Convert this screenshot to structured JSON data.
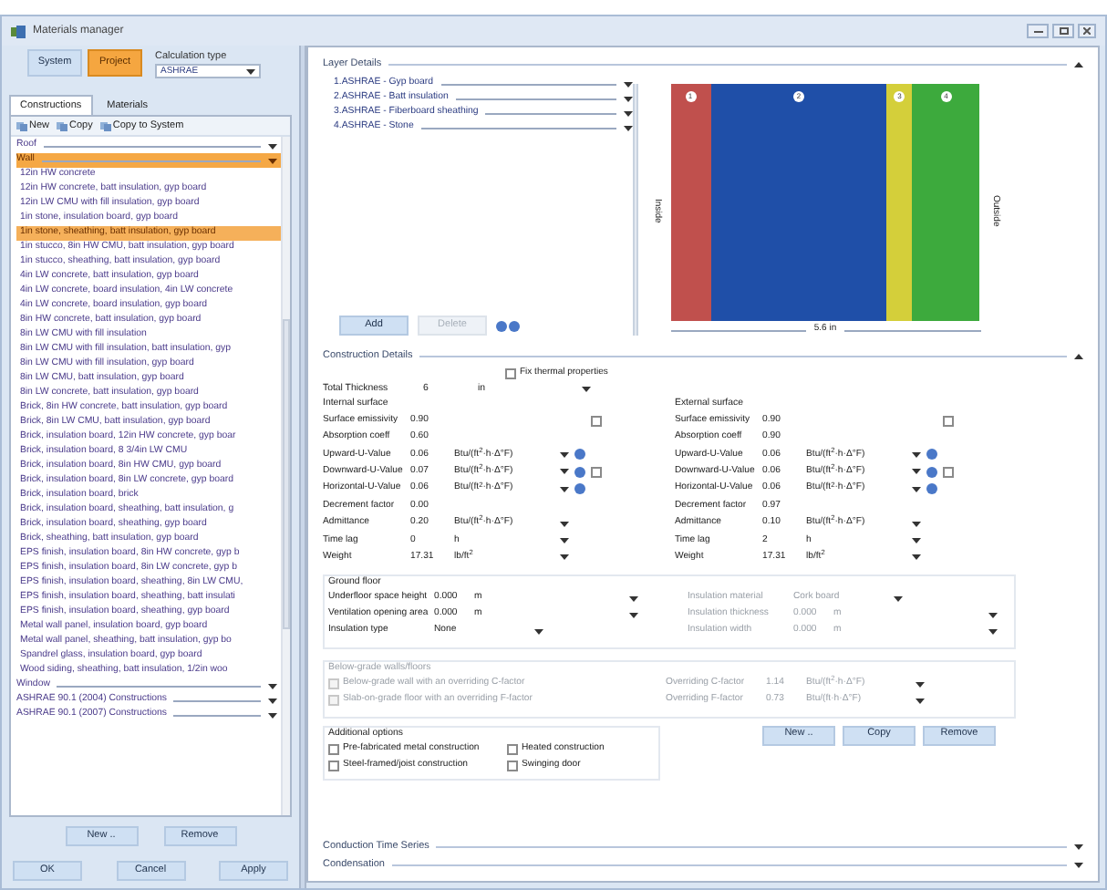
{
  "window": {
    "title": "Materials manager"
  },
  "mode_buttons": [
    {
      "label": "System",
      "selected": false
    },
    {
      "label": "Project",
      "selected": true
    }
  ],
  "calculation_type": {
    "label": "Calculation type",
    "value": "ASHRAE"
  },
  "tabs": [
    {
      "label": "Constructions",
      "selected": true
    },
    {
      "label": "Materials",
      "selected": false
    }
  ],
  "toolbar": [
    "New",
    "Copy",
    "Copy to System"
  ],
  "list": [
    {
      "kind": "group",
      "label": "Roof",
      "expanded": false,
      "selected": false
    },
    {
      "kind": "group",
      "label": "Wall",
      "expanded": true,
      "selected": true
    },
    {
      "kind": "item",
      "label": "12in HW concrete",
      "selected": false
    },
    {
      "kind": "item",
      "label": "12in HW concrete, batt insulation, gyp board",
      "selected": false
    },
    {
      "kind": "item",
      "label": "12in LW CMU with fill insulation, gyp board",
      "selected": false
    },
    {
      "kind": "item",
      "label": "1in stone, insulation board, gyp board",
      "selected": false
    },
    {
      "kind": "item",
      "label": "1in stone, sheathing, batt insulation, gyp board",
      "selected": true
    },
    {
      "kind": "item",
      "label": "1in stucco, 8in HW CMU, batt insulation, gyp board",
      "selected": false
    },
    {
      "kind": "item",
      "label": "1in stucco, sheathing, batt insulation, gyp board",
      "selected": false
    },
    {
      "kind": "item",
      "label": "4in LW concrete, batt insulation, gyp board",
      "selected": false
    },
    {
      "kind": "item",
      "label": "4in LW concrete, board insulation, 4in LW concrete",
      "selected": false
    },
    {
      "kind": "item",
      "label": "4in LW concrete, board insulation, gyp board",
      "selected": false
    },
    {
      "kind": "item",
      "label": "8in HW concrete, batt insulation, gyp board",
      "selected": false
    },
    {
      "kind": "item",
      "label": "8in LW CMU with fill insulation",
      "selected": false
    },
    {
      "kind": "item",
      "label": "8in LW CMU with fill insulation, batt insulation, gyp",
      "selected": false
    },
    {
      "kind": "item",
      "label": "8in LW CMU with fill insulation, gyp board",
      "selected": false
    },
    {
      "kind": "item",
      "label": "8in LW CMU, batt insulation, gyp board",
      "selected": false
    },
    {
      "kind": "item",
      "label": "8in LW concrete, batt insulation, gyp board",
      "selected": false
    },
    {
      "kind": "item",
      "label": "Brick, 8in HW concrete, batt insulation, gyp board",
      "selected": false
    },
    {
      "kind": "item",
      "label": "Brick, 8in LW CMU, batt insulation, gyp board",
      "selected": false
    },
    {
      "kind": "item",
      "label": "Brick, insulation board, 12in HW concrete, gyp boar",
      "selected": false
    },
    {
      "kind": "item",
      "label": "Brick, insulation board, 8 3/4in LW CMU",
      "selected": false
    },
    {
      "kind": "item",
      "label": "Brick, insulation board, 8in HW CMU, gyp board",
      "selected": false
    },
    {
      "kind": "item",
      "label": "Brick, insulation board, 8in LW concrete, gyp board",
      "selected": false
    },
    {
      "kind": "item",
      "label": "Brick, insulation board, brick",
      "selected": false
    },
    {
      "kind": "item",
      "label": "Brick, insulation board, sheathing, batt insulation, g",
      "selected": false
    },
    {
      "kind": "item",
      "label": "Brick, insulation board, sheathing, gyp board",
      "selected": false
    },
    {
      "kind": "item",
      "label": "Brick, sheathing, batt insulation, gyp board",
      "selected": false
    },
    {
      "kind": "item",
      "label": "EPS finish, insulation board, 8in HW concrete, gyp b",
      "selected": false
    },
    {
      "kind": "item",
      "label": "EPS finish, insulation board, 8in LW concrete, gyp b",
      "selected": false
    },
    {
      "kind": "item",
      "label": "EPS finish, insulation board, sheathing, 8in LW CMU,",
      "selected": false
    },
    {
      "kind": "item",
      "label": "EPS finish, insulation board, sheathing, batt insulati",
      "selected": false
    },
    {
      "kind": "item",
      "label": "EPS finish, insulation board, sheathing, gyp board",
      "selected": false
    },
    {
      "kind": "item",
      "label": "Metal wall panel, insulation board, gyp board",
      "selected": false
    },
    {
      "kind": "item",
      "label": "Metal wall panel, sheathing, batt insulation, gyp bo",
      "selected": false
    },
    {
      "kind": "item",
      "label": "Spandrel glass, insulation board, gyp board",
      "selected": false
    },
    {
      "kind": "item",
      "label": "Wood siding, sheathing, batt insulation, 1/2in woo",
      "selected": false
    },
    {
      "kind": "group",
      "label": "Window",
      "expanded": false,
      "selected": false
    },
    {
      "kind": "group",
      "label": "ASHRAE 90.1 (2004) Constructions",
      "expanded": false,
      "selected": false
    },
    {
      "kind": "group",
      "label": "ASHRAE 90.1 (2007) Constructions",
      "expanded": false,
      "selected": false
    }
  ],
  "list_buttons": [
    "New ..",
    "Remove"
  ],
  "dialog_buttons": [
    "OK",
    "Cancel",
    "Apply"
  ],
  "layer_details": {
    "title": "Layer Details",
    "layers": [
      "1.ASHRAE - Gyp board",
      "2.ASHRAE - Batt insulation",
      "3.ASHRAE - Fiberboard sheathing",
      "4.ASHRAE - Stone"
    ],
    "buttons": [
      {
        "label": "Add",
        "disabled": false
      },
      {
        "label": "Delete",
        "disabled": true
      }
    ],
    "diagram": {
      "inside_label": "Inside",
      "outside_label": "Outside",
      "width_label": "5.6 in",
      "bands": [
        {
          "number": "1",
          "color": "#c0504d"
        },
        {
          "number": "2",
          "color": "#1f4fa8"
        },
        {
          "number": "3",
          "color": "#d4cf3a"
        },
        {
          "number": "4",
          "color": "#3daa3d"
        }
      ]
    }
  },
  "construction_details": {
    "title": "Construction Details",
    "fix_thermal": {
      "label": "Fix thermal properties",
      "checked": false
    },
    "total_thickness": {
      "label": "Total Thickness",
      "value": "6",
      "unit": "in"
    },
    "surfaces": [
      {
        "title": "Internal surface",
        "rows": [
          {
            "label": "Surface emissivity",
            "value": "0.90",
            "checked": false
          },
          {
            "label": "Absorption coeff",
            "value": "0.60"
          },
          {
            "label": "Upward-U-Value",
            "value": "0.06",
            "unit": "Btu/(ft$^{2}$·h·Δ°F)",
            "info": true
          },
          {
            "label": "Downward-U-Value",
            "value": "0.07",
            "unit": "Btu/(ft$^{2}$·h·Δ°F)",
            "info": true,
            "checked": false
          },
          {
            "label": "Horizontal-U-Value",
            "value": "0.06",
            "unit": "Btu/(ft$^{2}$·h·Δ°F)",
            "info": true
          },
          {
            "label": "Decrement factor",
            "value": "0.00"
          },
          {
            "label": "Admittance",
            "value": "0.20",
            "unit": "Btu/(ft$^{2}$·h·Δ°F)",
            "info": false
          },
          {
            "label": "Time lag",
            "value": "0",
            "unit": "h",
            "info": false
          },
          {
            "label": "Weight",
            "value": "17.31",
            "unit": "lb/ft$^{2}$",
            "info": false
          }
        ]
      },
      {
        "title": "External surface",
        "rows": [
          {
            "label": "Surface emissivity",
            "value": "0.90",
            "checked": false
          },
          {
            "label": "Absorption coeff",
            "value": "0.90"
          },
          {
            "label": "Upward-U-Value",
            "value": "0.06",
            "unit": "Btu/(ft$^{2}$·h·Δ°F)",
            "info": true
          },
          {
            "label": "Downward-U-Value",
            "value": "0.06",
            "unit": "Btu/(ft$^{2}$·h·Δ°F)",
            "info": true,
            "checked": false
          },
          {
            "label": "Horizontal-U-Value",
            "value": "0.06",
            "unit": "Btu/(ft$^{2}$·h·Δ°F)",
            "info": true
          },
          {
            "label": "Decrement factor",
            "value": "0.97"
          },
          {
            "label": "Admittance",
            "value": "0.10",
            "unit": "Btu/(ft$^{2}$·h·Δ°F)",
            "info": false
          },
          {
            "label": "Time lag",
            "value": "2",
            "unit": "h",
            "info": false
          },
          {
            "label": "Weight",
            "value": "17.31",
            "unit": "lb/ft$^{2}$",
            "info": false
          }
        ]
      }
    ],
    "ground_floor": {
      "title": "Ground floor",
      "columns": [
        [
          {
            "label": "Underfloor space height",
            "value": "0.000",
            "unit": "m",
            "disabled": false
          },
          {
            "label": "Ventilation opening area",
            "value": "0.000",
            "unit": "m",
            "disabled": false
          },
          {
            "label": "Insulation type",
            "value": "None",
            "disabled": false
          }
        ],
        [
          {
            "label": "Insulation material",
            "value": "Cork board",
            "disabled": true
          },
          {
            "label": "Insulation thickness",
            "value": "0.000",
            "unit": "m",
            "disabled": true
          },
          {
            "label": "Insulation width",
            "value": "0.000",
            "unit": "m",
            "disabled": true
          }
        ]
      ]
    },
    "below_grade": {
      "title": "Below-grade walls/floors",
      "rows": [
        {
          "label": "Below-grade wall with an overriding C-factor",
          "checked": false,
          "factor_label": "Overriding C-factor",
          "value": "1.14",
          "unit": "Btu/(ft$^{2}$·h·Δ°F)"
        },
        {
          "label": "Slab-on-grade floor with an overriding F-factor",
          "checked": false,
          "factor_label": "Overriding F-factor",
          "value": "0.73",
          "unit": "Btu/(ft·h·Δ°F)"
        }
      ]
    },
    "additional_options": {
      "title": "Additional options",
      "options": [
        {
          "label": "Pre-fabricated metal construction",
          "checked": false
        },
        {
          "label": "Heated construction",
          "checked": false
        },
        {
          "label": "Steel-framed/joist construction",
          "checked": false
        },
        {
          "label": "Swinging door",
          "checked": false
        }
      ]
    },
    "buttons": [
      "New ..",
      "Copy",
      "Remove"
    ]
  },
  "collapsed_sections": [
    "Conduction Time Series",
    "Condensation"
  ]
}
